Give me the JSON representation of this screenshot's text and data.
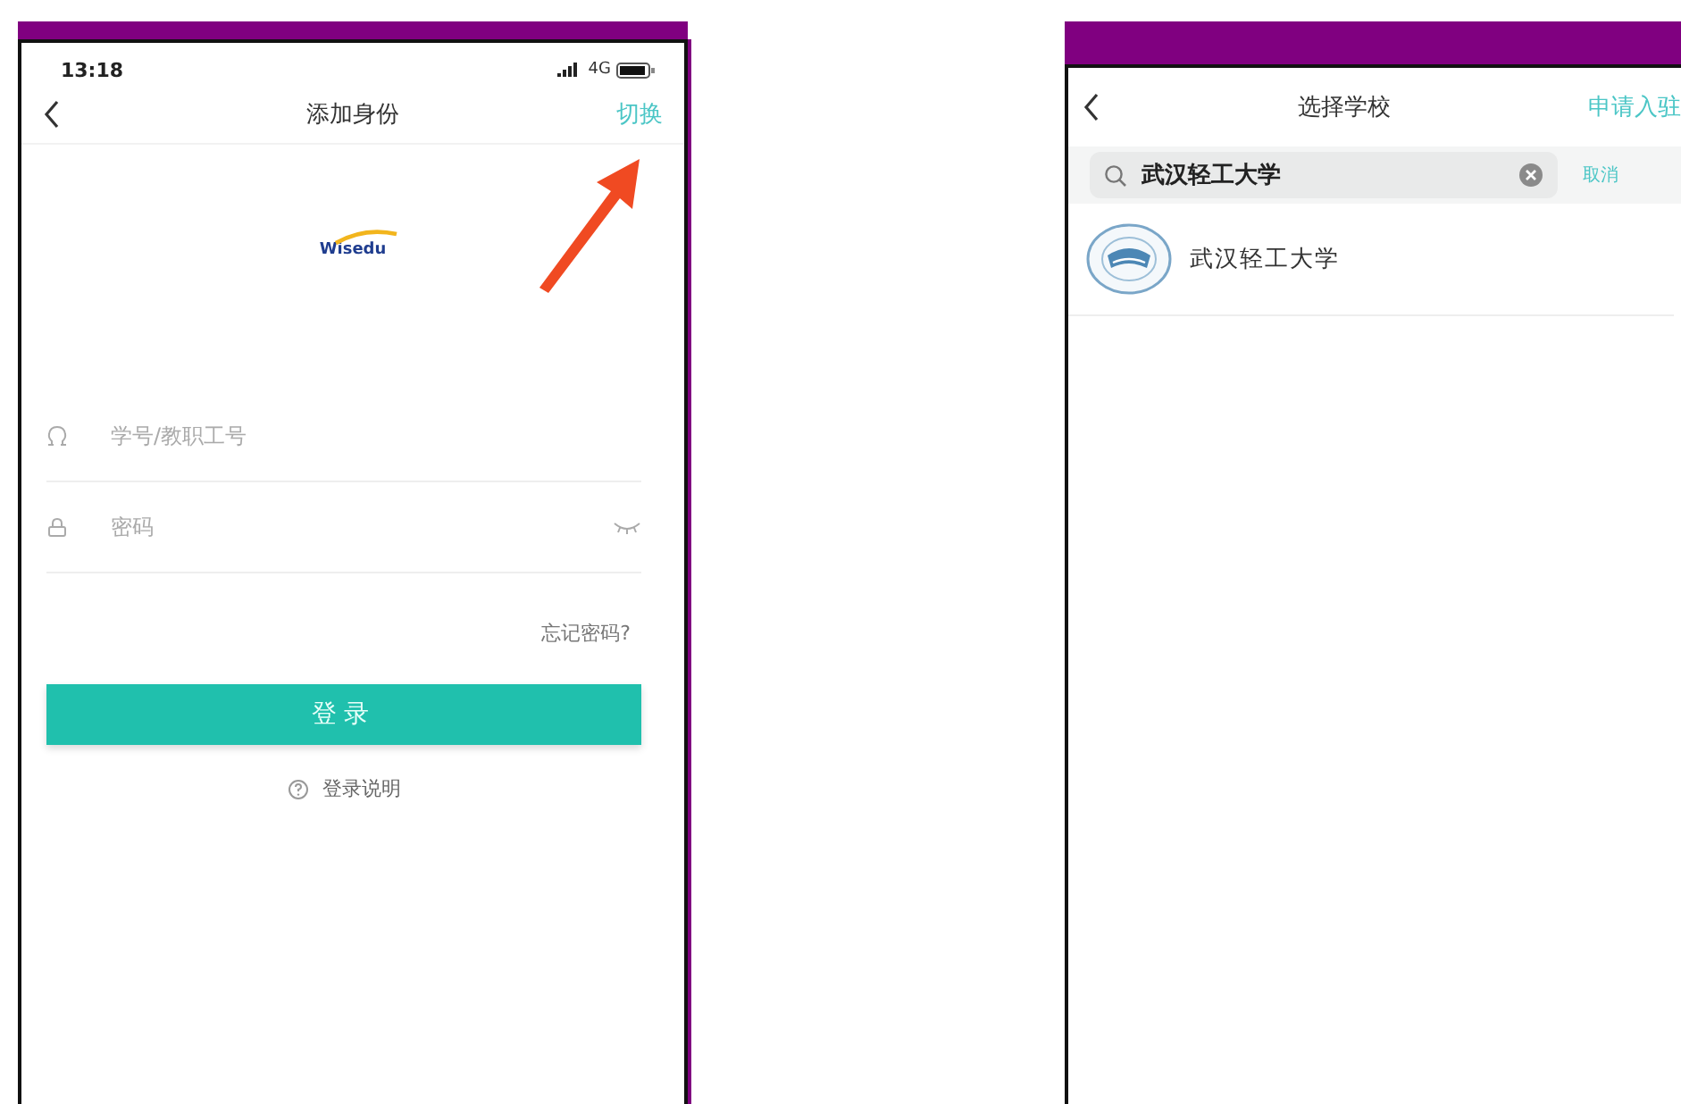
{
  "left_phone": {
    "status_bar": {
      "time": "13:18",
      "network": "4G"
    },
    "nav": {
      "title": "添加身份",
      "action": "切换"
    },
    "logo": {
      "text": "Wisedu"
    },
    "fields": [
      {
        "kind": "user",
        "placeholder": "学号/教职工号"
      },
      {
        "kind": "password",
        "placeholder": "密码"
      }
    ],
    "forgot_link": "忘记密码?",
    "login_button": "登录",
    "help_link": "登录说明"
  },
  "right_phone": {
    "nav": {
      "title": "选择学校",
      "action": "申请入驻"
    },
    "search": {
      "value": "武汉轻工大学",
      "cancel": "取消"
    },
    "results": [
      {
        "name": "武汉轻工大学"
      }
    ]
  }
}
